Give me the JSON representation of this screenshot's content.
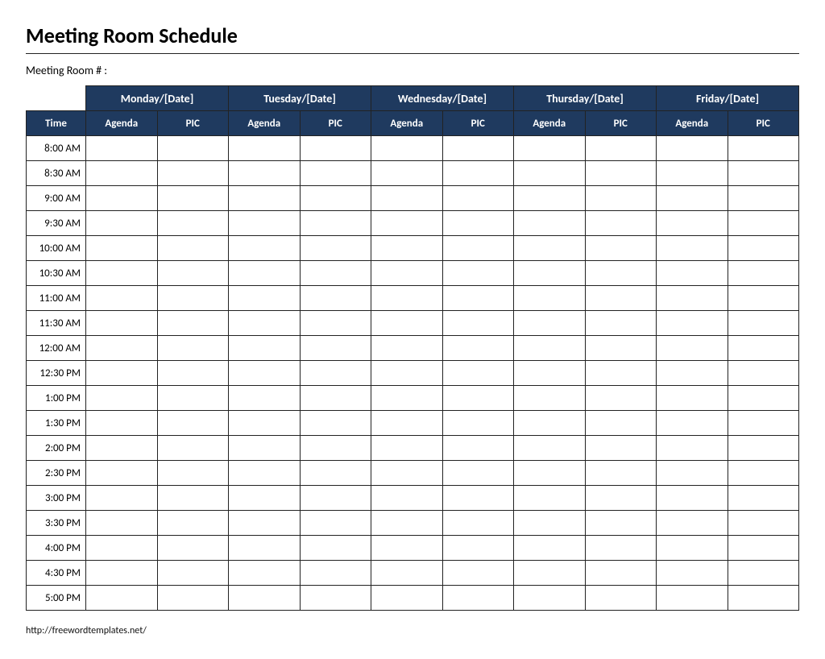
{
  "title": "Meeting Room Schedule",
  "room_label": "Meeting Room # :",
  "header": {
    "time_label": "Time",
    "days": [
      "Monday/[Date]",
      "Tuesday/[Date]",
      "Wednesday/[Date]",
      "Thursday/[Date]",
      "Friday/[Date]"
    ],
    "subcols": [
      "Agenda",
      "PIC"
    ]
  },
  "times": [
    "8:00 AM",
    "8:30 AM",
    "9:00 AM",
    "9:30 AM",
    "10:00 AM",
    "10:30 AM",
    "11:00 AM",
    "11:30 AM",
    "12:00 AM",
    "12:30 PM",
    "1:00 PM",
    "1:30 PM",
    "2:00 PM",
    "2:30 PM",
    "3:00 PM",
    "3:30 PM",
    "4:00 PM",
    "4:30 PM",
    "5:00 PM"
  ],
  "footer": "http://freewordtemplates.net/"
}
